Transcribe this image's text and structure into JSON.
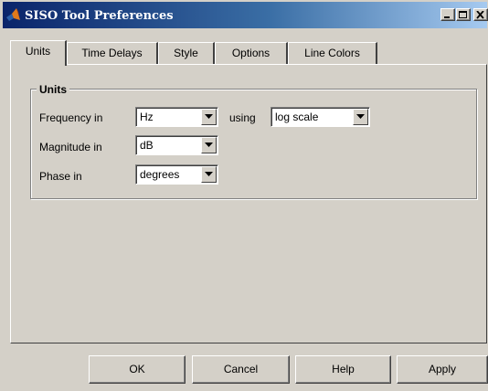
{
  "window": {
    "title": "SISO Tool Preferences",
    "icon": "matlab-icon",
    "controls": [
      "minimize-icon",
      "maximize-icon",
      "close-icon"
    ]
  },
  "tabs": [
    {
      "label": "Units",
      "active": true
    },
    {
      "label": "Time Delays",
      "active": false
    },
    {
      "label": "Style",
      "active": false
    },
    {
      "label": "Options",
      "active": false
    },
    {
      "label": "Line Colors",
      "active": false
    }
  ],
  "units_group": {
    "title": "Units",
    "frequency": {
      "label": "Frequency in",
      "value": "Hz"
    },
    "using_label": "using",
    "scale": {
      "value": "log scale"
    },
    "magnitude": {
      "label": "Magnitude in",
      "value": "dB"
    },
    "phase": {
      "label": "Phase in",
      "value": "degrees"
    }
  },
  "buttons": {
    "ok": "OK",
    "cancel": "Cancel",
    "help": "Help",
    "apply": "Apply"
  },
  "colors": {
    "titlebar_start": "#0a246a",
    "titlebar_end": "#a6caf0",
    "face": "#d4d0c8"
  }
}
